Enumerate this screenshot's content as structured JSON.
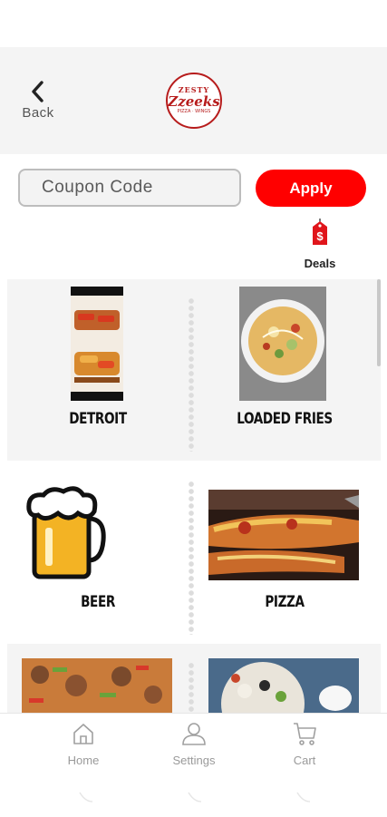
{
  "header": {
    "back_label": "Back",
    "logo": {
      "top": "ZESTY",
      "name": "Zzeeks",
      "sub": "PIZZA · WINGS"
    }
  },
  "coupon": {
    "placeholder": "Coupon Code",
    "value": ""
  },
  "apply_label": "Apply",
  "deals_label": "Deals",
  "colors": {
    "accent": "#ff0000",
    "header_bg": "#f4f4f4"
  },
  "categories": [
    {
      "label": "DETROIT"
    },
    {
      "label": "LOADED FRIES"
    },
    {
      "label": "BEER"
    },
    {
      "label": "PIZZA"
    },
    {
      "label": ""
    },
    {
      "label": ""
    }
  ],
  "nav": {
    "home": "Home",
    "settings": "Settings",
    "cart": "Cart"
  }
}
